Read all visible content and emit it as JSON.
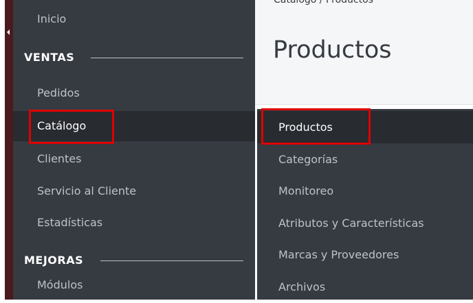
{
  "sidebar": {
    "top_item": "Inicio",
    "section_ventas": "VENTAS",
    "items_ventas": [
      {
        "label": "Pedidos"
      },
      {
        "label": "Catálogo"
      },
      {
        "label": "Clientes"
      },
      {
        "label": "Servicio al Cliente"
      },
      {
        "label": "Estadísticas"
      }
    ],
    "section_mejoras": "MEJORAS",
    "items_mejoras": [
      {
        "label": "Módulos"
      }
    ]
  },
  "header": {
    "breadcrumb": "Catálogo / Productos",
    "title": "Productos"
  },
  "submenu": {
    "items": [
      {
        "label": "Productos"
      },
      {
        "label": "Categorías"
      },
      {
        "label": "Monitoreo"
      },
      {
        "label": "Atributos y Características"
      },
      {
        "label": "Marcas y Proveedores"
      },
      {
        "label": "Archivos"
      }
    ]
  },
  "colors": {
    "sidebar_bg": "#363a41",
    "active_bg": "#282b30",
    "accent": "#25b9d7",
    "highlight_box": "#e00000"
  }
}
